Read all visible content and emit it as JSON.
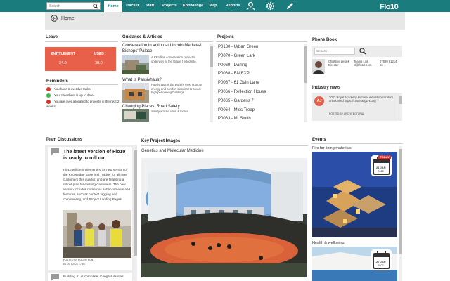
{
  "nav": {
    "search_placeholder": "Search",
    "items": [
      {
        "label": "Home"
      },
      {
        "label": "Tracker"
      },
      {
        "label": "Staff"
      },
      {
        "label": "Projects"
      },
      {
        "label": "Knowledge"
      },
      {
        "label": "Map"
      },
      {
        "label": "Reports"
      }
    ],
    "logo": "Flo10"
  },
  "breadcrumb": {
    "home": "Home"
  },
  "leave": {
    "title": "Leave",
    "entitlement_label": "ENTITLEMENT",
    "used_label": "USED",
    "entitlement_value": "34.0",
    "used_value": "30.0"
  },
  "reminders": {
    "title": "Reminders",
    "items": [
      {
        "text": "You have 6 overdue tasks",
        "color": "#e0302d"
      },
      {
        "text": "Your timesheet is up to date",
        "color": "#3cb54a"
      },
      {
        "text": "You are over allocated to projects in the next 2 weeks",
        "color": "#e0302d"
      }
    ]
  },
  "guidance": {
    "title": "Guidance & Articles",
    "articles": [
      {
        "title": "Conservation in action at Lincoln Medieval Bishops' Palace",
        "desc": "A £3million conservation project is underway at the Grade I listed site."
      },
      {
        "title": "What is Passivhaus?",
        "desc": "Passivhaus is the world's most rigorous energy and comfort standard to create high performing buildings"
      },
      {
        "title": "Changing Places, Road Safety",
        "desc": "Safety around vans & lorries"
      }
    ]
  },
  "projects": {
    "title": "Projects",
    "items": [
      "P0130 - Urban Green",
      "P0070 - Green Lark",
      "P0069 - Darling",
      "P0068 - BN EXP",
      "P0067 - 61 Gain Lane",
      "P0066 - Reflection House",
      "P0065 - Gardens 7",
      "P0064 - Miss Treap",
      "P0063 - Mr Smith"
    ]
  },
  "phonebook": {
    "title": "Phone Book",
    "search_placeholder": "Search",
    "entry": {
      "name": "Christine Leslek",
      "role": "Director",
      "team": "Teams Link",
      "email": "cl@flo10.com",
      "phone": "07899 81214",
      "ext": "56"
    }
  },
  "news": {
    "title": "Industry news",
    "avatar": "AJ",
    "text": "2022 Royal Academy summer exhibition curators announced https://t.co/exMg1HX0Ig",
    "meta": "POSTED BY ARCHITECTURAL"
  },
  "team_discussions": {
    "title": "Team Discussions",
    "heading": "The latest version of Flo10 is ready to roll out",
    "body": "Flo10 will be implementing its new version of the Knowledge Base and Tracker for all new customers this quarter, and are finalising a rollout plan for existing customers. The new version includes numerous enhancements and features, such as content tagging and commenting, and Project Landing Pages.",
    "posted_by": "POSTED BY ROGER HUNT",
    "posted_date": "04 OCT 2021 17:56",
    "next_preview": "Building 41 is complete. Congratulations"
  },
  "key_project": {
    "title": "Key Project Images",
    "subtitle": "Genetics and Molecular Medicine"
  },
  "events": {
    "title": "Events",
    "items": [
      {
        "label": "Fire for lining materials",
        "badge": "TODAY",
        "date": "21 JAN",
        "year": "2022"
      },
      {
        "label": "Health & wellbeing",
        "date": "27 JAN",
        "year": "2022"
      }
    ]
  },
  "colors": {
    "teal": "#1a7c7c",
    "accent": "#e8604a"
  }
}
